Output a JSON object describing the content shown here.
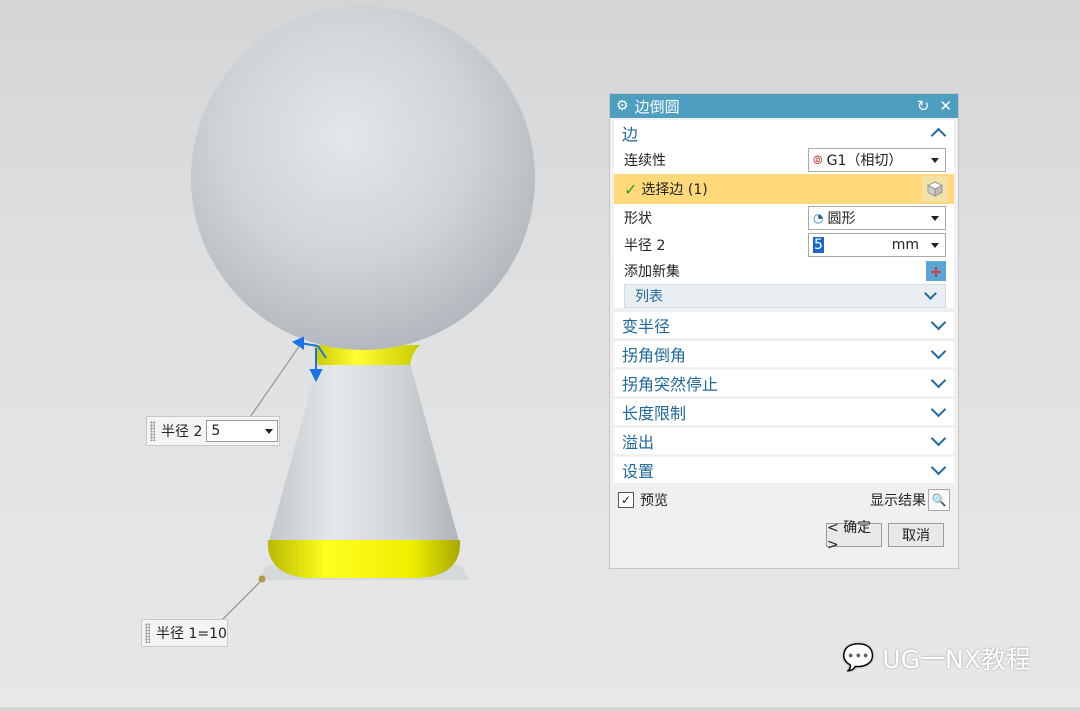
{
  "dialog": {
    "title": "边倒圆",
    "section_edge": {
      "title": "边",
      "continuity_label": "连续性",
      "continuity_value": "G1（相切）",
      "select_edge_label": "选择边 (1)",
      "shape_label": "形状",
      "shape_value": "圆形",
      "radius_label": "半径 2",
      "radius_value": "5",
      "radius_unit": "mm",
      "add_set_label": "添加新集",
      "list_label": "列表"
    },
    "collapsed_sections": [
      {
        "title": "变半径"
      },
      {
        "title": "拐角倒角"
      },
      {
        "title": "拐角突然停止"
      },
      {
        "title": "长度限制"
      },
      {
        "title": "溢出"
      },
      {
        "title": "设置"
      }
    ],
    "preview_label": "预览",
    "preview_checked": true,
    "show_result_label": "显示结果",
    "ok_label": "< 确定 >",
    "cancel_label": "取消"
  },
  "callouts": {
    "radius2_label": "半径 2",
    "radius2_value": "5",
    "radius1_label": "半径 1=10"
  },
  "watermark": "UG一NX教程",
  "colors": {
    "title_bar": "#4e9ec0",
    "section_text": "#1e6a9e",
    "selected_row": "#ffd97a",
    "highlight_yellow": "#f2f000",
    "model_gray": "#cdd2d6"
  }
}
